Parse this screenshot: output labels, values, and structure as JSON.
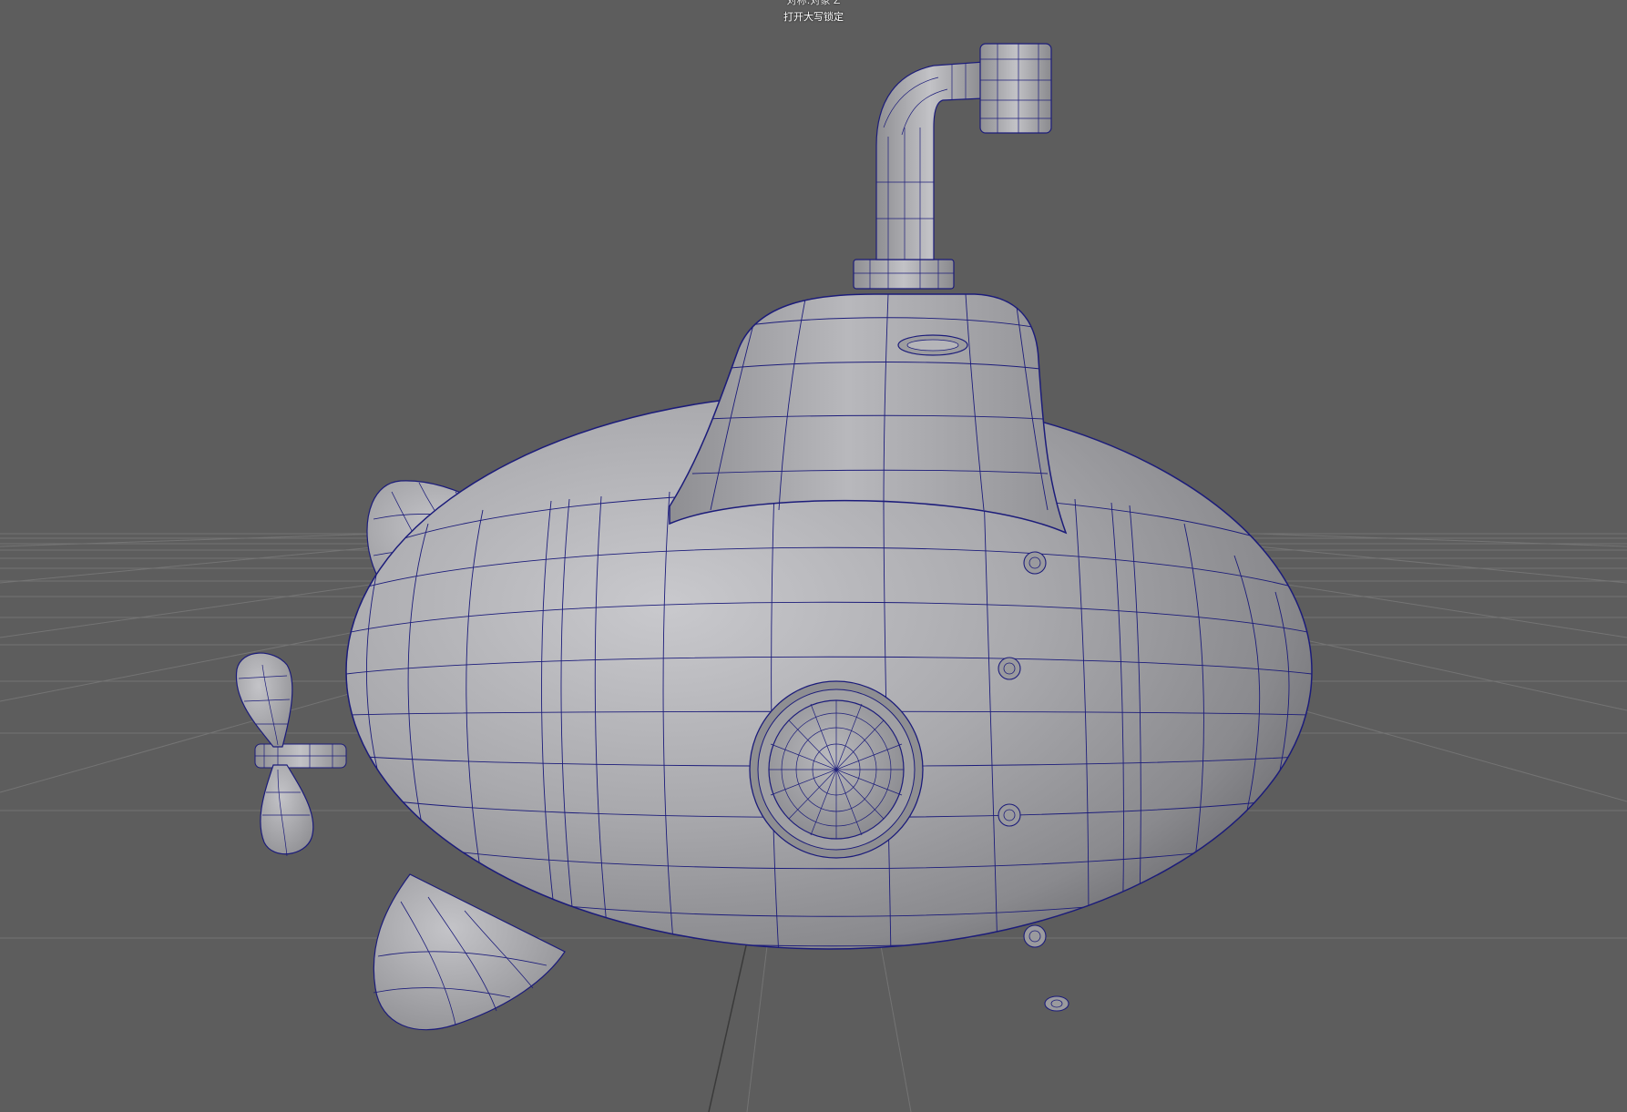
{
  "viewport": {
    "hud_top_line": "对称:对象 Z",
    "hud_caps_lock": "打开大写锁定",
    "background_color": "#5d5d5d",
    "wireframe_color": "#1c1c7a",
    "shaded_color": "#a4a4a8",
    "grid_color": "#7a7a7a"
  },
  "scene": {
    "object": "submarine",
    "parts": [
      "hull",
      "tower",
      "periscope",
      "porthole",
      "tail-fin",
      "propeller",
      "rivets"
    ]
  }
}
